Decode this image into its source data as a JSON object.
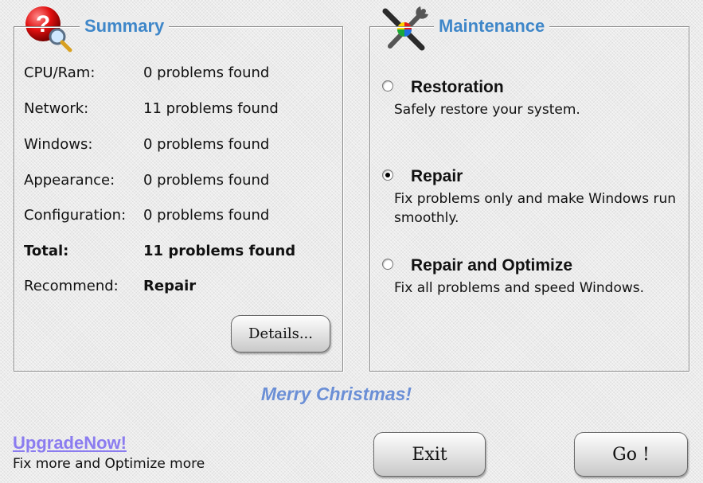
{
  "summary": {
    "title": "Summary",
    "rows": [
      {
        "label": "CPU/Ram:",
        "value": "0  problems found"
      },
      {
        "label": "Network:",
        "value": "11  problems found"
      },
      {
        "label": "Windows:",
        "value": "0  problems found"
      },
      {
        "label": "Appearance:",
        "value": "0  problems found"
      },
      {
        "label": "Configuration:",
        "value": "0  problems found"
      }
    ],
    "total": {
      "label": "Total:",
      "value": "11  problems found"
    },
    "recommend": {
      "label": "Recommend:",
      "value": "Repair"
    },
    "details_label": "Details..."
  },
  "maintenance": {
    "title": "Maintenance",
    "options": [
      {
        "title": "Restoration",
        "desc": "Safely restore your system.",
        "selected": false
      },
      {
        "title": "Repair",
        "desc": "Fix problems only and make Windows run smoothly.",
        "selected": true
      },
      {
        "title": "Repair and Optimize",
        "desc": "Fix all problems and speed Windows.",
        "selected": false
      }
    ]
  },
  "footer": {
    "greeting": "Merry Christmas!",
    "upgrade_link": "UpgradeNow!",
    "upgrade_sub": "Fix more and Optimize more",
    "exit_label": "Exit",
    "go_label": "Go !"
  },
  "colors": {
    "title_blue": "#3f87c9",
    "greeting_blue": "#6b8fd6",
    "link_purple": "#8b7cf0"
  },
  "icons": {
    "summary": "question-magnifier-icon",
    "maintenance": "tools-icon"
  }
}
